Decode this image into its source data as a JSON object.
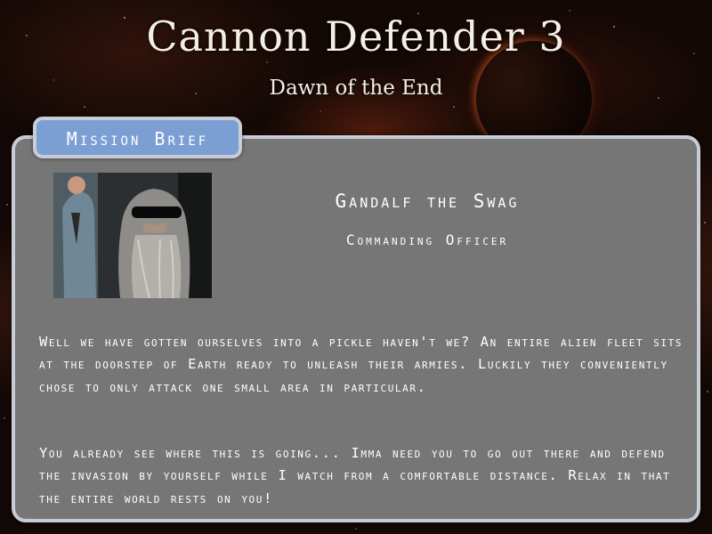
{
  "game": {
    "title": "Cannon Defender 3",
    "subtitle": "Dawn of the End"
  },
  "mission_brief": {
    "tab_label": "Mission Brief",
    "officer": {
      "name": "Gandalf the Swag",
      "rank": "Commanding Officer",
      "portrait_icon": "officer-portrait"
    },
    "paragraphs": [
      "Well we have gotten ourselves into a pickle haven't we? An entire alien fleet sits at the doorstep of Earth ready to unleash their armies. Luckily they conveniently chose to only attack one small area in particular.",
      "You already see where this is going... Imma need you to go out there and defend the invasion by yourself while I watch from a comfortable distance. Relax in that the entire world rests on you!"
    ]
  },
  "colors": {
    "panel": "#767676",
    "panel_border": "#c8ccd6",
    "tab": "#7b9fd2",
    "text": "#ffffff"
  }
}
